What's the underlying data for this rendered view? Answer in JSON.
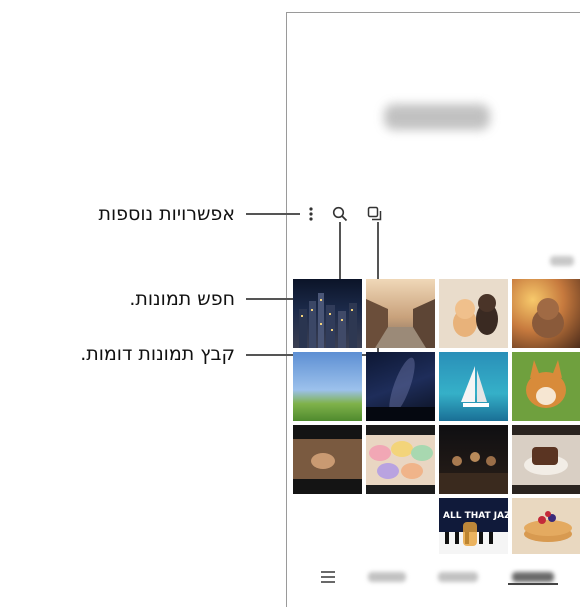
{
  "annotations": {
    "more_options": "אפשרויות נוספות",
    "search_pictures": "חפש תמונות.",
    "group_similar": "קבץ תמונות דומות."
  },
  "toolbar": {
    "icons": [
      "more-options-icon",
      "search-icon",
      "group-similar-icon"
    ]
  },
  "gallery": {
    "thumbnails": [
      "city-skyline-at-night",
      "street-of-traditional-houses",
      "kitten-and-puppy",
      "puppy-with-bokeh-lights",
      "sky-over-green-field",
      "milky-way-over-trees",
      "sailboat-in-turquoise-sea",
      "smiling-corgi",
      "hands-playing-guitar",
      "colorful-macarons",
      "band-performing-on-stage",
      "chocolate-dessert",
      "all-that-jazz-poster",
      "pancakes-with-berries"
    ]
  },
  "bottom_nav": {
    "menu_icon": "menu-icon"
  },
  "colors": {
    "leader_line": "#555555",
    "frame": "#9a9a9a"
  }
}
